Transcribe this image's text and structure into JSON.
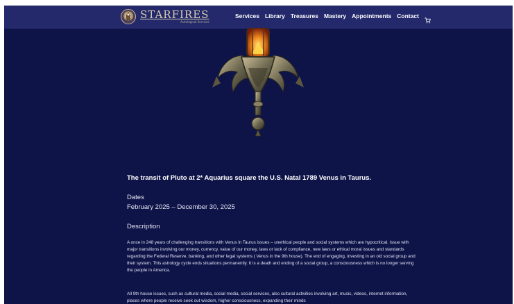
{
  "brand": {
    "name": "STARFIRES",
    "tagline": "Astrological Services"
  },
  "nav": {
    "items": [
      "Services",
      "Library",
      "Treasures",
      "Mastery",
      "Appointments",
      "Contact"
    ],
    "cart_icon": "cart-icon"
  },
  "hero": {
    "image": "ornate-lantern"
  },
  "article": {
    "title": "The transit of Pluto at 2* Aquarius square the U.S. Natal 1789 Venus in Taurus.",
    "dates_label": "Dates",
    "dates_value": "February 2025 – December 30, 2025",
    "description_label": "Description",
    "paragraphs": [
      "A once in 248 years of challenging transitions with Venus in Taurus issues – unethical people and social systems which are hypocritical. Issue with major transitions involving our money, currency, value of our money, laws or lack of compliance, new laws or ethical moral issues and standards regarding the Federal Reserve, banking, and other legal systems ( Venus in the 9th house). The end of engaging, investing in an old social group and their system. This astrology cycle ends situations permanently. It is a death and ending of a social group, a consciousness which is no longer serving the people in America.",
      "All 9th house issues, such as cultural media, social media, social services, also cultural activities involving art, music, videos, internet information, places where people receive seek out wisdom, higher consciousness, expanding their minds"
    ]
  },
  "colors": {
    "background": "#0f1448",
    "header": "#23296b",
    "text": "#ffffff"
  }
}
